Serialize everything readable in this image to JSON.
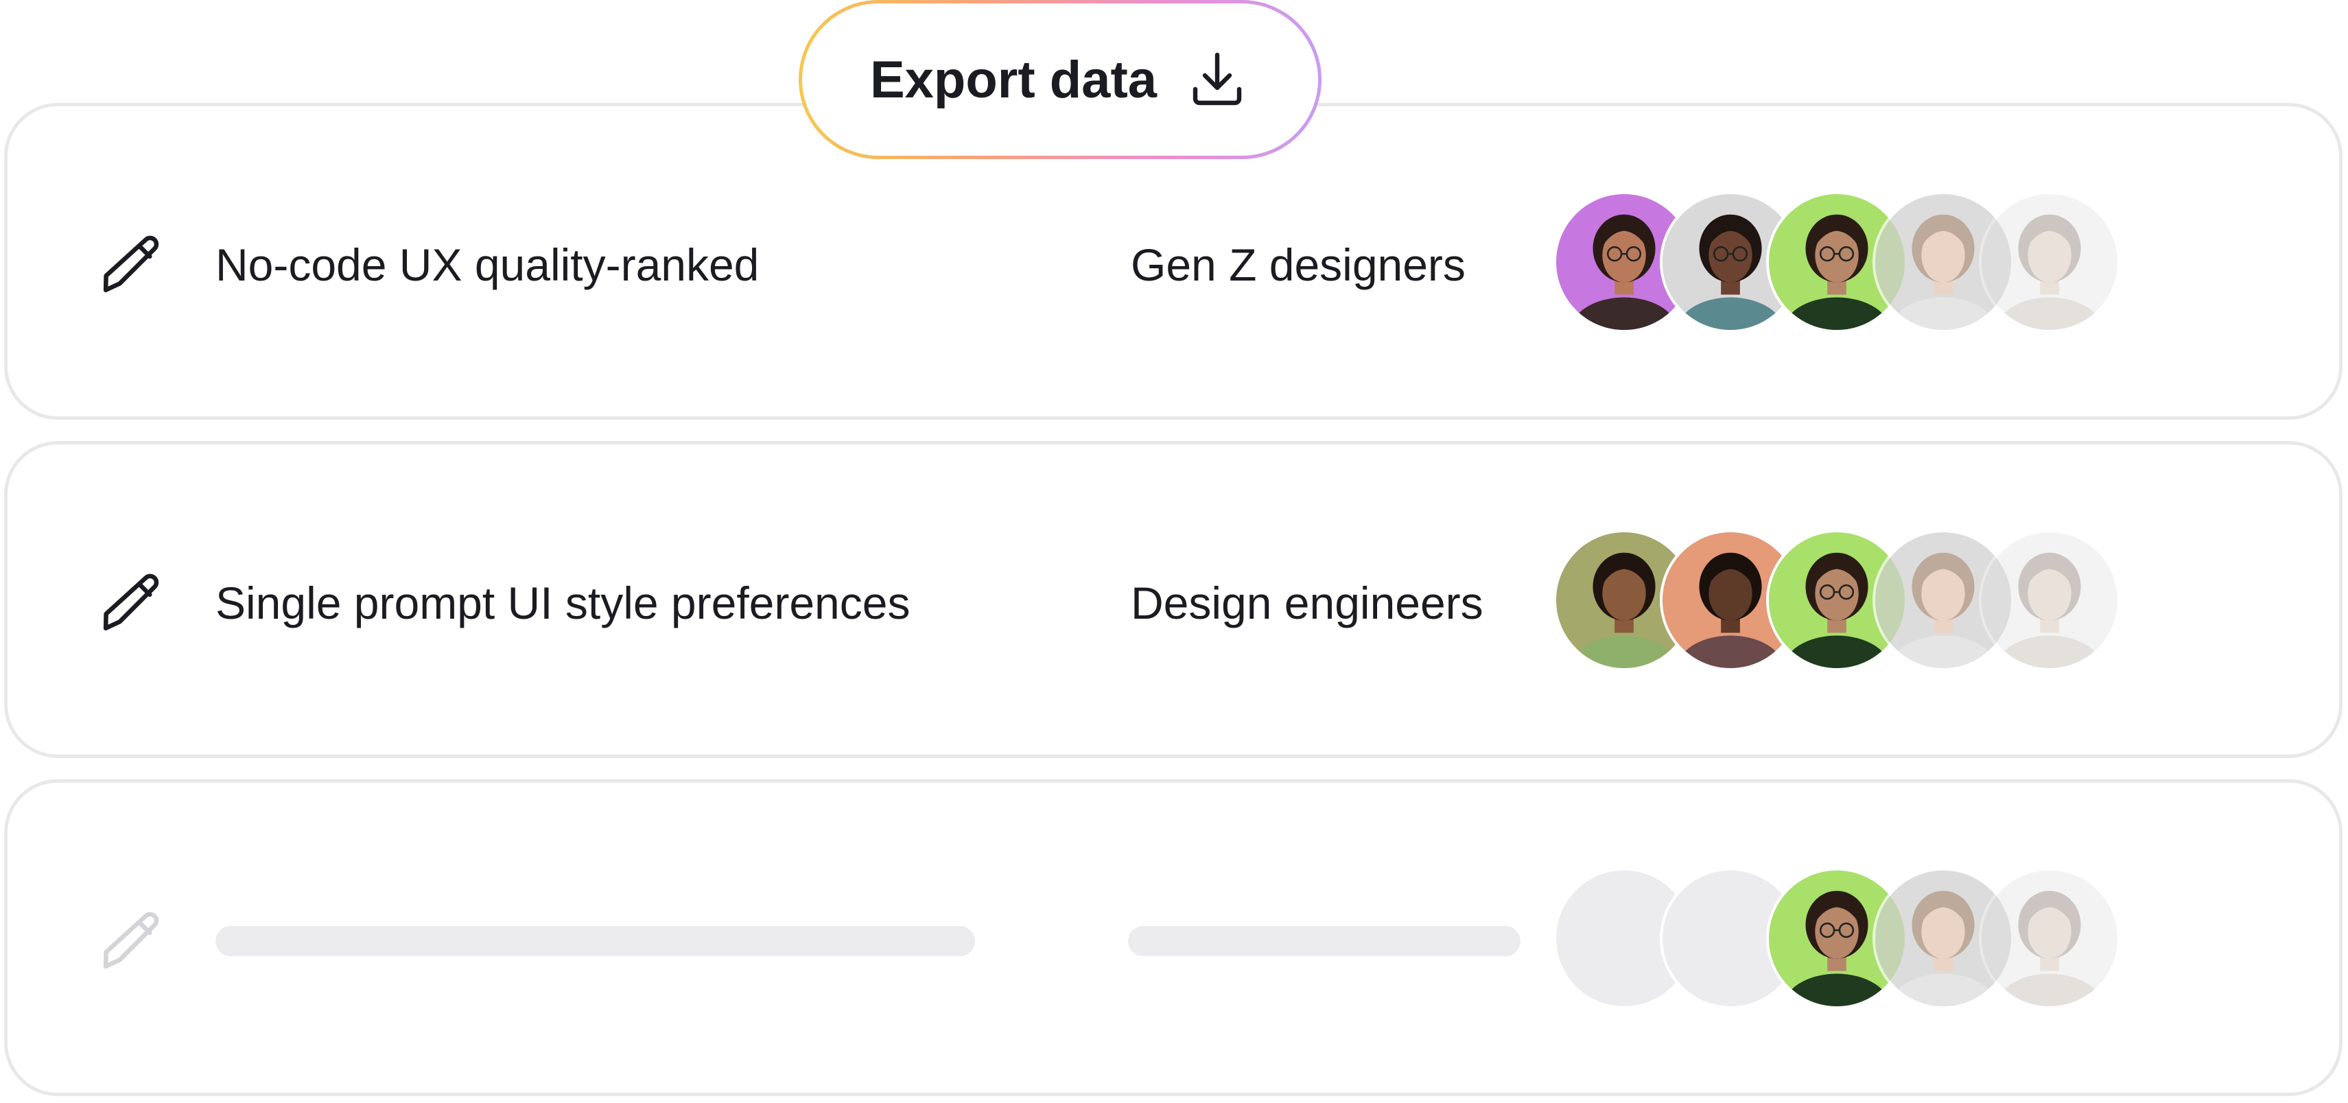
{
  "export": {
    "label": "Export data",
    "icon": "download-icon"
  },
  "rows": [
    {
      "title": "No-code UX quality-ranked",
      "audience": "Gen Z designers",
      "icon": "pencil-icon",
      "avatars": [
        {
          "bg": "#c777e0",
          "skin": "#b97a5c",
          "hair": "#2a1a16",
          "shirt": "#3a2a2a",
          "glasses": true
        },
        {
          "bg": "#d9d9d9",
          "skin": "#6b4330",
          "hair": "#1f1512",
          "shirt": "#5a8a8f",
          "glasses": true
        },
        {
          "bg": "#a8e06a",
          "skin": "#b7876a",
          "hair": "#2a1c14",
          "shirt": "#1f3a1f",
          "glasses": true
        },
        {
          "bg": "#cfcfcf",
          "skin": "#e2c4b0",
          "hair": "#a58a74",
          "shirt": "#dcdcdc",
          "glasses": false
        },
        {
          "bg": "#e0e0e0",
          "skin": "#c9b3a3",
          "hair": "#7a6a60",
          "shirt": "#b9b0a6",
          "glasses": false
        }
      ]
    },
    {
      "title": "Single prompt UI style preferences",
      "audience": "Design engineers",
      "icon": "pencil-icon",
      "avatars": [
        {
          "bg": "#a4a86a",
          "skin": "#8a5a3c",
          "hair": "#1f1410",
          "shirt": "#8fb06a",
          "glasses": false
        },
        {
          "bg": "#e59a78",
          "skin": "#5e3a28",
          "hair": "#1a100c",
          "shirt": "#6a4a4a",
          "glasses": false
        },
        {
          "bg": "#a8e06a",
          "skin": "#b7876a",
          "hair": "#2a1c14",
          "shirt": "#1f3a1f",
          "glasses": true
        },
        {
          "bg": "#cfcfcf",
          "skin": "#e2c4b0",
          "hair": "#a58a74",
          "shirt": "#dcdcdc",
          "glasses": false
        },
        {
          "bg": "#e0e0e0",
          "skin": "#c9b3a3",
          "hair": "#7a6a60",
          "shirt": "#b9b0a6",
          "glasses": false
        }
      ]
    },
    {
      "title": "",
      "audience": "",
      "icon": "pencil-icon",
      "avatars": [
        {
          "placeholder": true
        },
        {
          "placeholder": true
        },
        {
          "bg": "#a8e06a",
          "skin": "#b7876a",
          "hair": "#2a1c14",
          "shirt": "#1f3a1f",
          "glasses": true
        },
        {
          "bg": "#cfcfcf",
          "skin": "#e2c4b0",
          "hair": "#a58a74",
          "shirt": "#dcdcdc",
          "glasses": false
        },
        {
          "bg": "#e0e0e0",
          "skin": "#c9b3a3",
          "hair": "#7a6a60",
          "shirt": "#b9b0a6",
          "glasses": false
        }
      ]
    }
  ],
  "colors": {
    "border": "#e8e8ea",
    "text": "#1b1b22",
    "skeleton": "#ececef",
    "faded_icon": "#d4d4d8"
  }
}
